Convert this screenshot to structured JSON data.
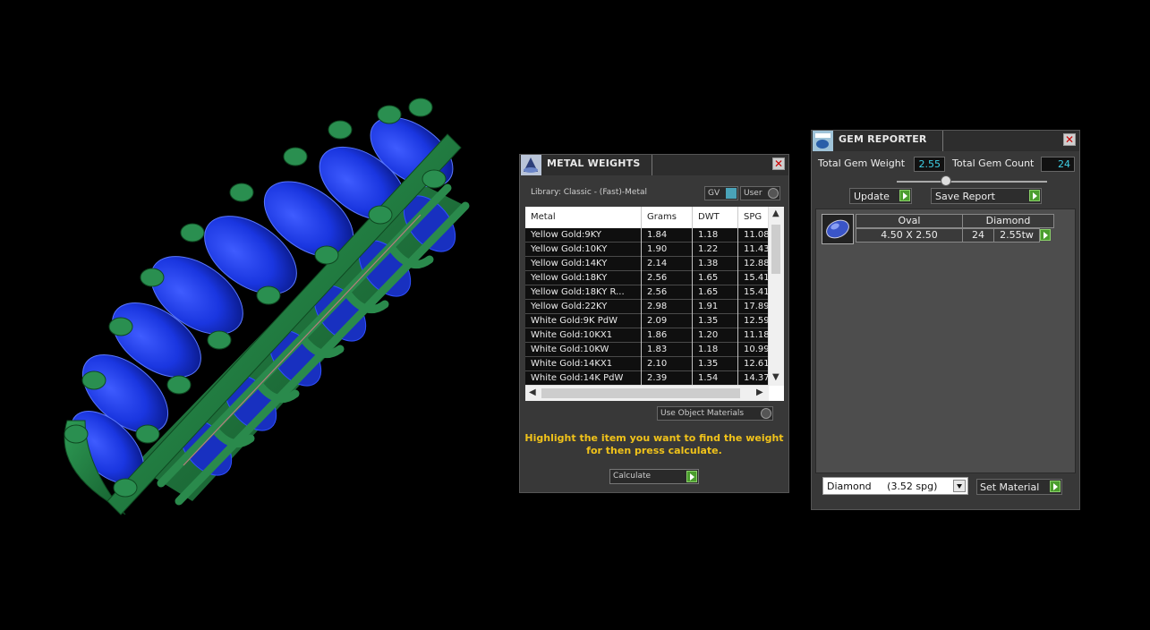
{
  "metal_weights": {
    "title": "METAL WEIGHTS",
    "library_label": "Library: Classic - (Fast)-Metal",
    "toggle_gv": "GV",
    "toggle_user": "User",
    "columns": [
      "Metal",
      "Grams",
      "DWT",
      "SPG"
    ],
    "rows": [
      [
        "Yellow Gold:9KY",
        "1.84",
        "1.18",
        "11.08"
      ],
      [
        "Yellow Gold:10KY",
        "1.90",
        "1.22",
        "11.43"
      ],
      [
        "Yellow Gold:14KY",
        "2.14",
        "1.38",
        "12.88"
      ],
      [
        "Yellow Gold:18KY",
        "2.56",
        "1.65",
        "15.41"
      ],
      [
        "Yellow Gold:18KY R...",
        "2.56",
        "1.65",
        "15.41"
      ],
      [
        "Yellow Gold:22KY",
        "2.98",
        "1.91",
        "17.89"
      ],
      [
        "White Gold:9K PdW",
        "2.09",
        "1.35",
        "12.59"
      ],
      [
        "White Gold:10KX1",
        "1.86",
        "1.20",
        "11.18"
      ],
      [
        "White Gold:10KW",
        "1.83",
        "1.18",
        "10.99"
      ],
      [
        "White Gold:14KX1",
        "2.10",
        "1.35",
        "12.61"
      ],
      [
        "White Gold:14K PdW",
        "2.39",
        "1.54",
        "14.37"
      ]
    ],
    "use_object_materials": "Use Object Materials",
    "hint_line1": "Highlight the item you want to find the weight",
    "hint_line2": "for then press calculate.",
    "calculate_label": "Calculate"
  },
  "gem_reporter": {
    "title": "GEM REPORTER",
    "total_weight_label": "Total Gem Weight",
    "total_weight_value": "2.55",
    "total_count_label": "Total Gem Count",
    "total_count_value": "24",
    "update_label": "Update",
    "save_report_label": "Save Report",
    "gem": {
      "shape": "Oval",
      "material": "Diamond",
      "size": "4.50 X 2.50",
      "count": "24",
      "weight": "2.55tw"
    },
    "material_select": "Diamond     (3.52 spg)",
    "set_material_label": "Set Material"
  },
  "colors": {
    "accent_hint": "#f0c21a",
    "value_text": "#3fd0e6",
    "gem_blue": "#1a3cff",
    "metal_green": "#1f7a3e",
    "button_green": "#4a9d2d"
  }
}
